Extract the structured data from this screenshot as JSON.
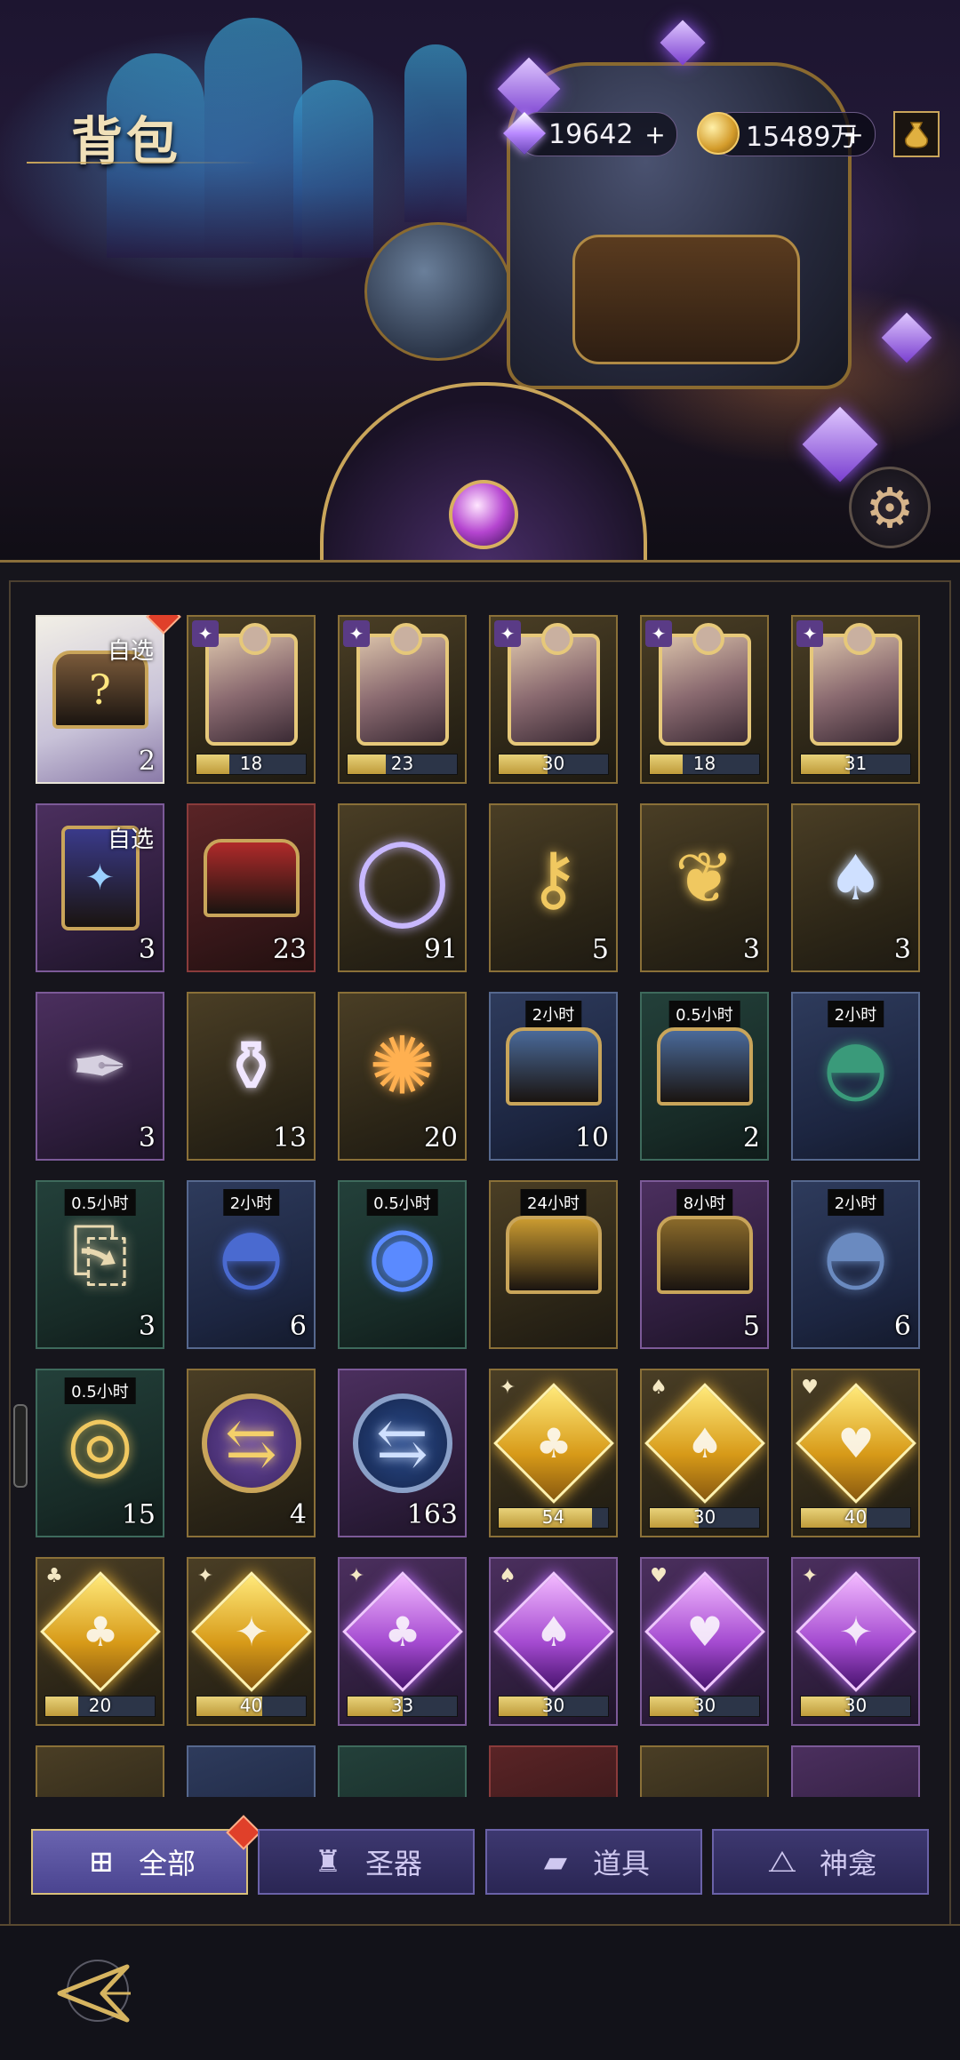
{
  "header": {
    "title": "背包",
    "gems": "19642",
    "gold": "15489万",
    "add": "+"
  },
  "colors": {
    "accent_gold": "#c9a55a",
    "tab_active": "#6a64b0",
    "progress_fill": "#e8d27a",
    "badge_red": "#e0402a"
  },
  "icons": [
    "gem-icon",
    "coin-icon",
    "plus-icon",
    "bag-icon",
    "gear-icon",
    "back-icon",
    "all-icon",
    "artifact-icon",
    "props-icon",
    "shrine-icon"
  ],
  "grid": {
    "rows": [
      [
        {
          "type": "select",
          "bg": "white",
          "icon": "mystery-chest",
          "label": "自选",
          "count": "2",
          "dot": true
        },
        {
          "type": "puzzle",
          "bg": "gold",
          "icon": "puzzle-portrait",
          "progress": "18",
          "fill": 0.3
        },
        {
          "type": "puzzle",
          "bg": "gold",
          "icon": "puzzle-portrait",
          "progress": "23",
          "fill": 0.35
        },
        {
          "type": "puzzle",
          "bg": "gold",
          "icon": "puzzle-portrait",
          "progress": "30",
          "fill": 0.45
        },
        {
          "type": "puzzle",
          "bg": "gold",
          "icon": "puzzle-portrait",
          "progress": "18",
          "fill": 0.3
        },
        {
          "type": "puzzle",
          "bg": "gold",
          "icon": "puzzle-portrait",
          "progress": "31",
          "fill": 0.45
        }
      ],
      [
        {
          "type": "select",
          "bg": "purple",
          "icon": "card-pack",
          "label": "自选",
          "count": "3"
        },
        {
          "type": "item",
          "bg": "red",
          "icon": "red-chest",
          "count": "23"
        },
        {
          "type": "item",
          "bg": "gold",
          "icon": "crystal-ring",
          "count": "91"
        },
        {
          "type": "item",
          "bg": "gold",
          "icon": "key",
          "count": "5"
        },
        {
          "type": "item",
          "bg": "gold",
          "icon": "gold-feather",
          "count": "3"
        },
        {
          "type": "item",
          "bg": "gold",
          "icon": "spade-feather",
          "count": "3"
        }
      ],
      [
        {
          "type": "item",
          "bg": "purple",
          "icon": "quill",
          "count": "3"
        },
        {
          "type": "item",
          "bg": "gold",
          "icon": "potion",
          "count": "13"
        },
        {
          "type": "item",
          "bg": "gold",
          "icon": "fireworks",
          "count": "20"
        },
        {
          "type": "timer",
          "bg": "blue",
          "icon": "blue-chest",
          "timer": "2小时",
          "count": "10"
        },
        {
          "type": "timer",
          "bg": "green",
          "icon": "blue-chest",
          "timer": "0.5小时",
          "count": "2"
        },
        {
          "type": "timer",
          "bg": "blue",
          "icon": "green-sack",
          "timer": "2小时",
          "count": ""
        }
      ],
      [
        {
          "type": "timer",
          "bg": "green",
          "icon": "scroll",
          "timer": "0.5小时",
          "count": "3"
        },
        {
          "type": "timer",
          "bg": "blue",
          "icon": "exp-sack",
          "timer": "2小时",
          "count": "6"
        },
        {
          "type": "timer",
          "bg": "green",
          "icon": "exp-bubbles",
          "timer": "0.5小时",
          "count": ""
        },
        {
          "type": "timer",
          "bg": "gold",
          "icon": "treasure-chest",
          "timer": "24小时",
          "count": ""
        },
        {
          "type": "timer",
          "bg": "purple",
          "icon": "gold-chest",
          "timer": "8小时",
          "count": "5"
        },
        {
          "type": "timer",
          "bg": "blue",
          "icon": "coin-sack",
          "timer": "2小时",
          "count": "6"
        }
      ],
      [
        {
          "type": "timer",
          "bg": "green",
          "icon": "coin-stack",
          "timer": "0.5小时",
          "count": "15"
        },
        {
          "type": "item",
          "bg": "gold",
          "icon": "gold-swap-token",
          "count": "4"
        },
        {
          "type": "item",
          "bg": "purple",
          "icon": "blue-swap-token",
          "count": "163"
        },
        {
          "type": "shard",
          "bg": "gold",
          "icon": "gold-shard",
          "suit": "♣",
          "badge": "✦",
          "progress": "54",
          "fill": 0.85
        },
        {
          "type": "shard",
          "bg": "gold",
          "icon": "gold-shard",
          "suit": "♠",
          "badge": "♠",
          "progress": "30",
          "fill": 0.45
        },
        {
          "type": "shard",
          "bg": "gold",
          "icon": "gold-shard",
          "suit": "♥",
          "badge": "♥",
          "progress": "40",
          "fill": 0.6
        }
      ],
      [
        {
          "type": "shard",
          "bg": "gold",
          "icon": "gold-shard",
          "suit": "♣",
          "badge": "♣",
          "progress": "20",
          "fill": 0.3
        },
        {
          "type": "shard",
          "bg": "gold",
          "icon": "gold-shard",
          "suit": "✦",
          "badge": "✦",
          "progress": "40",
          "fill": 0.6
        },
        {
          "type": "shard",
          "bg": "purple",
          "icon": "purple-shard",
          "suit": "♣",
          "badge": "✦",
          "progress": "33",
          "fill": 0.5
        },
        {
          "type": "shard",
          "bg": "purple",
          "icon": "purple-shard",
          "suit": "♠",
          "badge": "♠",
          "progress": "30",
          "fill": 0.45
        },
        {
          "type": "shard",
          "bg": "purple",
          "icon": "purple-shard",
          "suit": "♥",
          "badge": "♥",
          "progress": "30",
          "fill": 0.45
        },
        {
          "type": "shard",
          "bg": "purple",
          "icon": "purple-shard",
          "suit": "✦",
          "badge": "✦",
          "progress": "30",
          "fill": 0.45
        }
      ],
      [
        {
          "type": "item",
          "bg": "gold",
          "icon": "partial",
          "count": ""
        },
        {
          "type": "item",
          "bg": "blue",
          "icon": "partial",
          "count": ""
        },
        {
          "type": "item",
          "bg": "green",
          "icon": "partial",
          "count": ""
        },
        {
          "type": "item",
          "bg": "red",
          "icon": "partial",
          "count": ""
        },
        {
          "type": "item",
          "bg": "gold",
          "icon": "partial",
          "count": ""
        },
        {
          "type": "item",
          "bg": "purple",
          "icon": "partial",
          "count": ""
        }
      ]
    ]
  },
  "tabs": [
    {
      "label": "全部",
      "icon": "all-icon",
      "active": true,
      "dot": true
    },
    {
      "label": "圣器",
      "icon": "artifact-icon",
      "active": false
    },
    {
      "label": "道具",
      "icon": "props-icon",
      "active": false
    },
    {
      "label": "神龛",
      "icon": "shrine-icon",
      "active": false
    }
  ]
}
